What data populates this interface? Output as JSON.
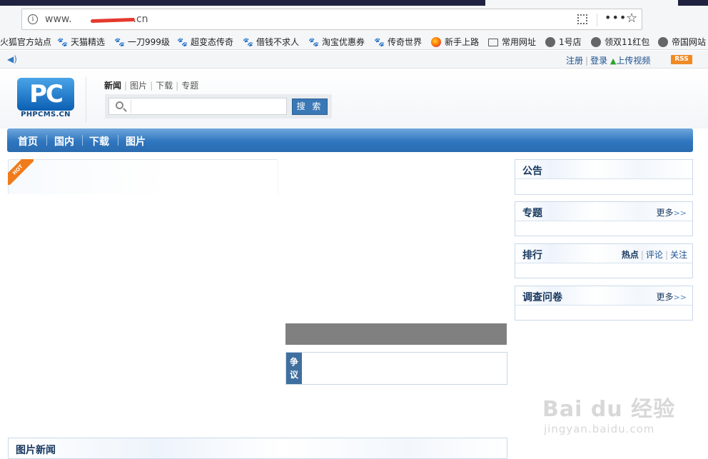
{
  "browser": {
    "url_prefix": "www.",
    "url_suffix": ".cn",
    "bookmarks": [
      {
        "label": "火狐官方站点",
        "icon": "firefox-icon"
      },
      {
        "label": "天猫精选",
        "icon": "paw-icon"
      },
      {
        "label": "一刀999级",
        "icon": "paw-icon"
      },
      {
        "label": "超变态传奇",
        "icon": "paw-icon"
      },
      {
        "label": "借钱不求人",
        "icon": "paw-icon"
      },
      {
        "label": "淘宝优惠券",
        "icon": "paw-icon"
      },
      {
        "label": "传奇世界",
        "icon": "paw-icon"
      },
      {
        "label": "新手上路",
        "icon": "firefox-icon"
      },
      {
        "label": "常用网址",
        "icon": "folder-icon"
      },
      {
        "label": "1号店",
        "icon": "globe-icon"
      },
      {
        "label": "领双11红包",
        "icon": "globe-icon"
      },
      {
        "label": "帝国网站",
        "icon": "globe-icon"
      }
    ]
  },
  "topbar": {
    "register": "注册",
    "login": "登录",
    "upload_video": "上传视频",
    "rss": "RSS"
  },
  "header": {
    "logo_mark": "PC",
    "logo_text": "PHPCMS.CN",
    "search_tabs": [
      "新闻",
      "图片",
      "下载",
      "专题"
    ],
    "search_input_value": "",
    "search_button": "搜 索"
  },
  "nav": {
    "items": [
      "首页",
      "国内",
      "下载",
      "图片"
    ]
  },
  "hot_badge": "HOT",
  "debate_label": "争议",
  "panels": {
    "announcement": {
      "title": "公告"
    },
    "topics": {
      "title": "专题",
      "more": "更多",
      "more_arrows": ">>"
    },
    "ranking": {
      "title": "排行",
      "tabs": [
        "热点",
        "评论",
        "关注"
      ]
    },
    "survey": {
      "title": "调查问卷",
      "more": "更多",
      "more_arrows": ">>"
    }
  },
  "photo_news": {
    "title": "图片新闻"
  },
  "watermark": {
    "main": "Bai du 经验",
    "sub": "jingyan.baidu.com"
  }
}
